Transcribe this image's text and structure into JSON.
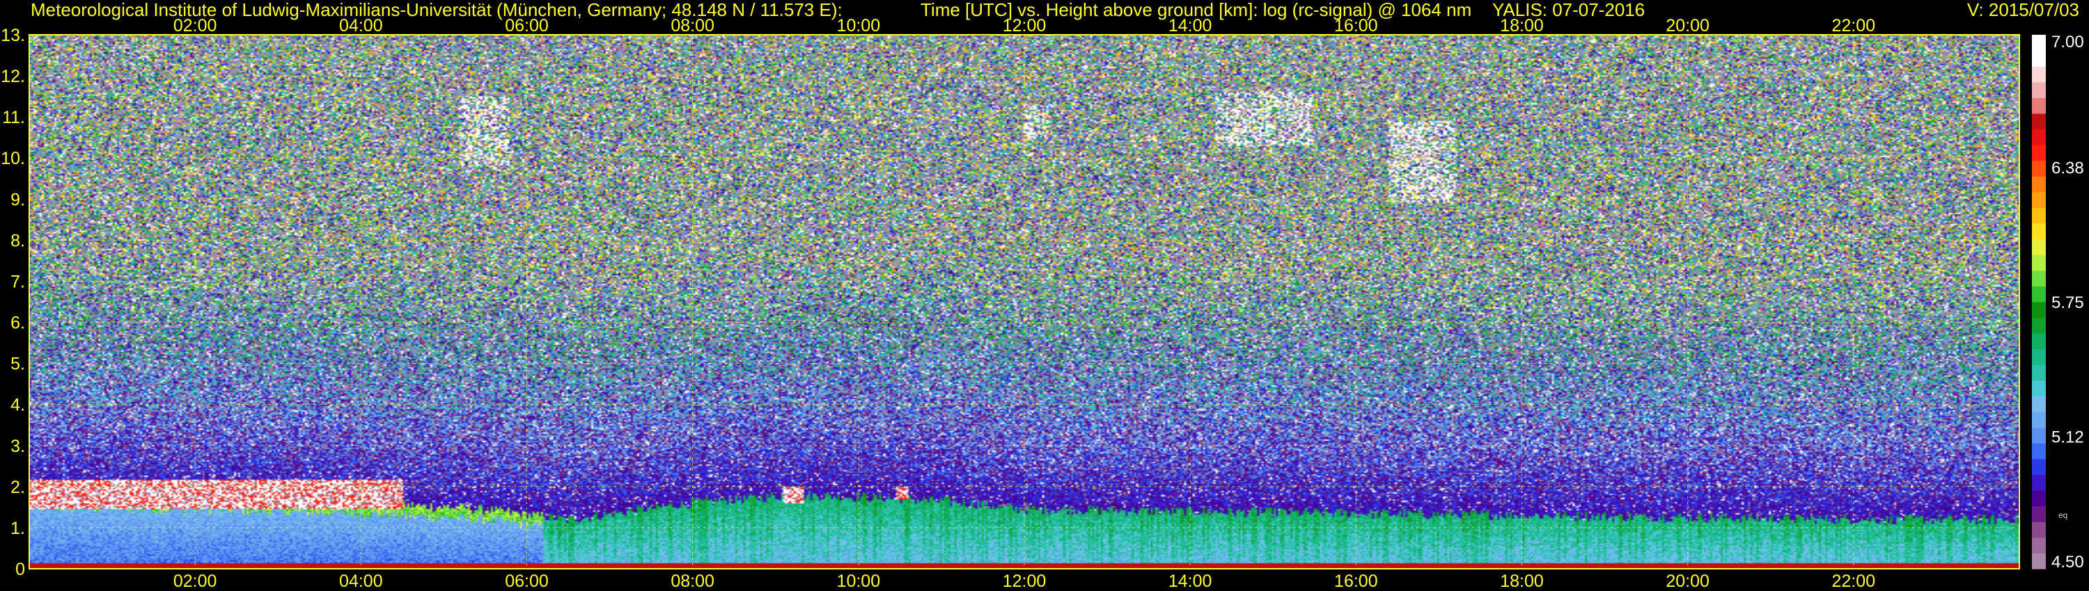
{
  "header": {
    "institute": "Meteorological Institute of Ludwig-Maximilians-Universität (München, Germany; 48.148 N / 11.573 E):",
    "title": "Time [UTC] vs. Height above ground [km]: log (rc-signal) @ 1064 nm",
    "instrument_date": "YALIS: 07-07-2016",
    "version": "V: 2015/07/03"
  },
  "colorbar": {
    "tick_labels": [
      "7.00",
      "6.38",
      "5.75",
      "5.12",
      "4.50"
    ],
    "tick_values": [
      7.0,
      6.38,
      5.75,
      5.12,
      4.5
    ],
    "small_label": "eq",
    "colors": [
      "#a88aa6",
      "#9a6a9c",
      "#8a4a8c",
      "#6a1a86",
      "#4a0090",
      "#3a18c8",
      "#2a3ae8",
      "#3a6af0",
      "#5a90f0",
      "#6aaaf0",
      "#7abcf0",
      "#4ac8d8",
      "#2ac0a8",
      "#1ab888",
      "#10b060",
      "#10a030",
      "#109010",
      "#30c030",
      "#70e040",
      "#b0f040",
      "#e8f040",
      "#ffe020",
      "#ffc010",
      "#ffa010",
      "#ff8010",
      "#ff5010",
      "#ff2010",
      "#e81010",
      "#c01010",
      "#e87a7a",
      "#f0b0b0",
      "#f8d8d8",
      "#ffffff",
      "#ffffff"
    ]
  },
  "chart_data": {
    "type": "heatmap",
    "title": "Time [UTC] vs. Height above ground [km]: log (rc-signal) @ 1064 nm",
    "xlabel": "Time [UTC]",
    "ylabel": "Height above ground [km]",
    "x_ticks": [
      "02:00",
      "04:00",
      "06:00",
      "08:00",
      "10:00",
      "12:00",
      "14:00",
      "16:00",
      "18:00",
      "20:00",
      "22:00"
    ],
    "x_tick_values": [
      2,
      4,
      6,
      8,
      10,
      12,
      14,
      16,
      18,
      20,
      22
    ],
    "xlim": [
      0,
      24
    ],
    "y_ticks": [
      "0",
      "1.",
      "2.",
      "3.",
      "4.",
      "5.",
      "6.",
      "7.",
      "8.",
      "9.",
      "10.",
      "11.",
      "12.",
      "13."
    ],
    "y_tick_values": [
      0,
      1,
      2,
      3,
      4,
      5,
      6,
      7,
      8,
      9,
      10,
      11,
      12,
      13
    ],
    "ylim": [
      0,
      13
    ],
    "value_range": [
      4.5,
      7.0
    ],
    "grid": true,
    "boundary_layer_top_km": [
      [
        0.0,
        1.75
      ],
      [
        2.0,
        1.7
      ],
      [
        4.0,
        1.6
      ],
      [
        5.5,
        1.45
      ],
      [
        6.5,
        1.2
      ],
      [
        8.0,
        1.6
      ],
      [
        9.2,
        1.8
      ],
      [
        10.0,
        1.75
      ],
      [
        11.0,
        1.65
      ],
      [
        12.0,
        1.45
      ],
      [
        14.0,
        1.4
      ],
      [
        16.0,
        1.35
      ],
      [
        18.0,
        1.3
      ],
      [
        20.0,
        1.25
      ],
      [
        22.0,
        1.2
      ],
      [
        24.0,
        1.2
      ]
    ],
    "cloud_layers": [
      {
        "t_start": 0.0,
        "t_end": 4.5,
        "base_km": 1.45,
        "top_km": 2.15
      },
      {
        "t_start": 9.1,
        "t_end": 9.35,
        "base_km": 1.6,
        "top_km": 2.0
      },
      {
        "t_start": 10.45,
        "t_end": 10.6,
        "base_km": 1.7,
        "top_km": 2.0
      }
    ],
    "cirrus_patches": [
      {
        "t_start": 5.2,
        "t_end": 5.8,
        "base_km": 9.8,
        "top_km": 11.5
      },
      {
        "t_start": 12.0,
        "t_end": 12.3,
        "base_km": 10.5,
        "top_km": 11.3
      },
      {
        "t_start": 14.3,
        "t_end": 15.5,
        "base_km": 10.3,
        "top_km": 11.6
      },
      {
        "t_start": 16.4,
        "t_end": 17.2,
        "base_km": 8.9,
        "top_km": 10.9
      }
    ]
  }
}
